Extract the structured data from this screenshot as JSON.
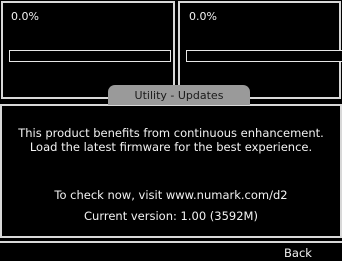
{
  "decks": [
    {
      "id": "left",
      "percent_text": "0.0%",
      "progress": 0
    },
    {
      "id": "right",
      "percent_text": "0.0%",
      "progress": 0
    }
  ],
  "dialog": {
    "title": "Utility - Updates",
    "message": "This product benefits from continuous enhancement. Load the latest firmware for the best experience.",
    "visit_text": "To check now, visit www.numark.com/d2",
    "version_text": "Current version: 1.00 (3592M)"
  },
  "softkeys": {
    "back_label": "Back"
  },
  "colors": {
    "background": "#000000",
    "border": "#d8d8d8",
    "tab": "#9a9a9a",
    "text": "#f2f2f2"
  }
}
